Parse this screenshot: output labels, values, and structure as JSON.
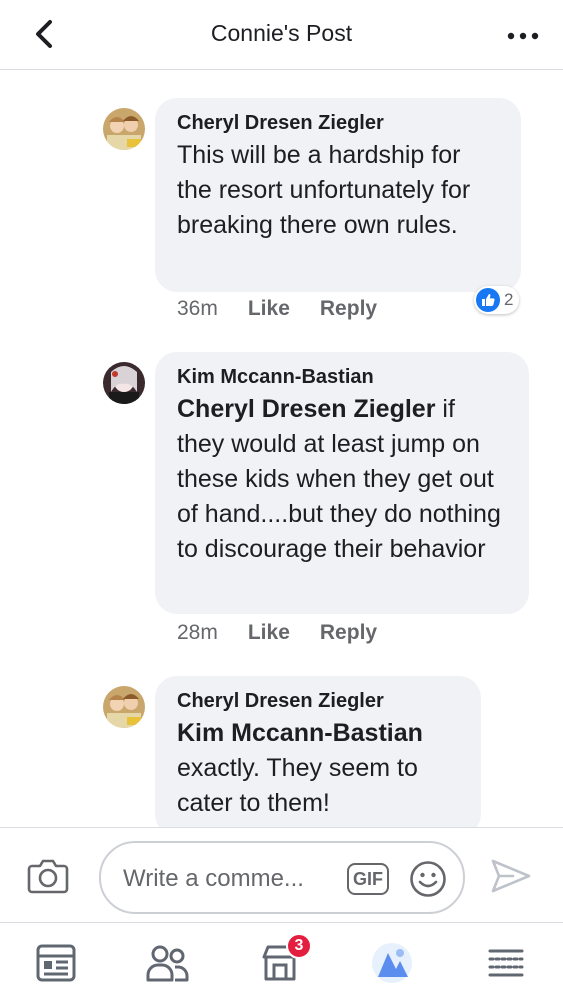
{
  "header": {
    "title": "Connie's Post",
    "back_icon": "chevron-left-icon",
    "more_icon": "more-horizontal-icon"
  },
  "comments": [
    {
      "author": "Cheryl Dresen Ziegler",
      "mention": "",
      "text": "This will be a hardship for the resort unfortunately for breaking there own rules.",
      "time": "36m",
      "like_label": "Like",
      "reply_label": "Reply",
      "reaction_count": "2"
    },
    {
      "author": "Kim Mccann-Bastian",
      "mention": "Cheryl Dresen Ziegler",
      "text": " if they would at least jump on these kids when they get out of hand....but they do nothing to discourage their behavior",
      "time": "28m",
      "like_label": "Like",
      "reply_label": "Reply"
    },
    {
      "author": "Cheryl Dresen Ziegler",
      "mention": "Kim Mccann-Bastian",
      "text": "exactly.  They seem to cater to them!"
    }
  ],
  "composer": {
    "placeholder": "Write a comme...",
    "gif_label": "GIF"
  },
  "tabbar": {
    "notifications_badge": "3"
  },
  "colors": {
    "accent": "#1877f2",
    "bubble": "#f0f2f5",
    "badge": "#e41e3f"
  }
}
